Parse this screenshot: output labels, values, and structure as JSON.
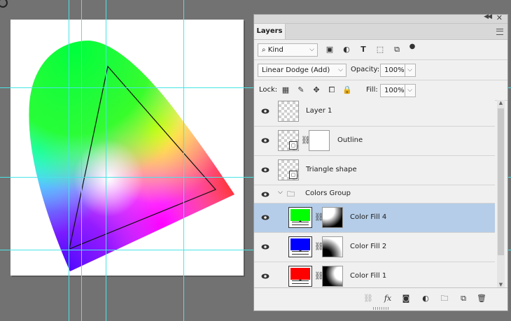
{
  "panel": {
    "tab_label": "Layers",
    "filter": {
      "kind_label": "Kind"
    },
    "blend": {
      "mode": "Linear Dodge (Add)",
      "opacity_label": "Opacity:",
      "opacity_value": "100%"
    },
    "lock": {
      "lock_label": "Lock:",
      "fill_label": "Fill:",
      "fill_value": "100%"
    }
  },
  "layers": [
    {
      "name": "Layer 1",
      "kind": "pixel"
    },
    {
      "name": "Outline",
      "kind": "smart-with-mask"
    },
    {
      "name": "Triangle shape",
      "kind": "smart"
    },
    {
      "name": "Colors Group",
      "kind": "group"
    },
    {
      "name": "Color Fill 4",
      "kind": "fill",
      "color": "#00ff00",
      "selected": true
    },
    {
      "name": "Color Fill 2",
      "kind": "fill",
      "color": "#0000ff"
    },
    {
      "name": "Color Fill 1",
      "kind": "fill",
      "color": "#ff0000"
    }
  ],
  "colors": {
    "guide": "#49e4e6",
    "selection": "#b5cde8",
    "workspace": "#727272"
  }
}
